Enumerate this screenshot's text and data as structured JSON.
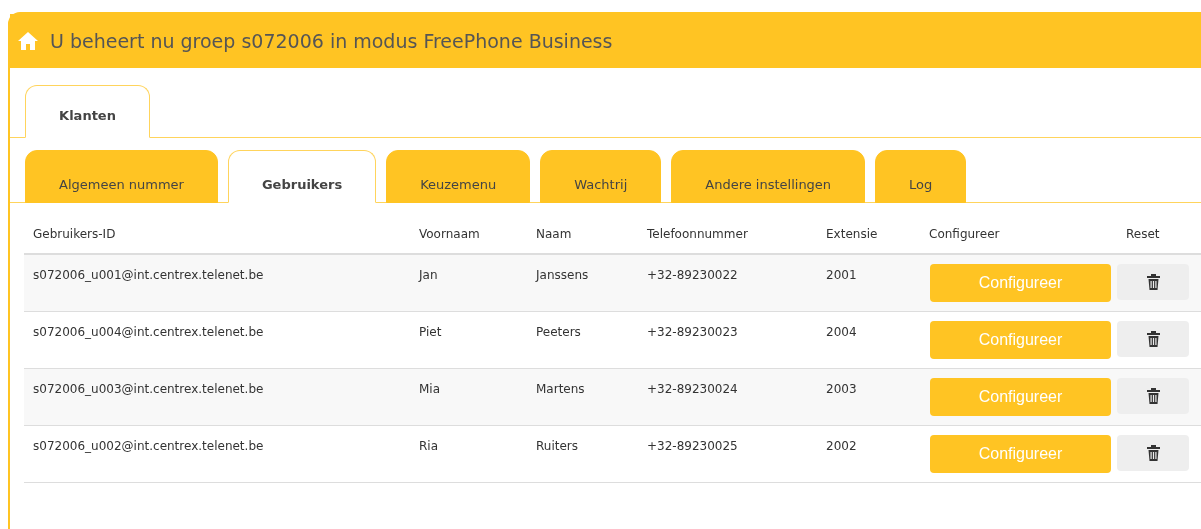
{
  "header": {
    "title": "U beheert nu groep s072006 in modus FreePhone Business"
  },
  "main_tabs": [
    {
      "label": "Klanten",
      "selected": true
    }
  ],
  "sub_tabs": [
    {
      "label": "Algemeen nummer",
      "selected": false
    },
    {
      "label": "Gebruikers",
      "selected": true
    },
    {
      "label": "Keuzemenu",
      "selected": false
    },
    {
      "label": "Wachtrij",
      "selected": false
    },
    {
      "label": "Andere instellingen",
      "selected": false
    },
    {
      "label": "Log",
      "selected": false
    }
  ],
  "table": {
    "columns": [
      "Gebruikers-ID",
      "Voornaam",
      "Naam",
      "Telefoonnummer",
      "Extensie",
      "Configureer",
      "Reset"
    ],
    "rows": [
      {
        "id": "s072006_u001@int.centrex.telenet.be",
        "first_name": "Jan",
        "last_name": "Janssens",
        "phone": "+32-89230022",
        "extension": "2001",
        "configure": "Configureer"
      },
      {
        "id": "s072006_u004@int.centrex.telenet.be",
        "first_name": "Piet",
        "last_name": "Peeters",
        "phone": "+32-89230023",
        "extension": "2004",
        "configure": "Configureer"
      },
      {
        "id": "s072006_u003@int.centrex.telenet.be",
        "first_name": "Mia",
        "last_name": "Martens",
        "phone": "+32-89230024",
        "extension": "2003",
        "configure": "Configureer"
      },
      {
        "id": "s072006_u002@int.centrex.telenet.be",
        "first_name": "Ria",
        "last_name": "Ruiters",
        "phone": "+32-89230025",
        "extension": "2002",
        "configure": "Configureer"
      }
    ]
  }
}
